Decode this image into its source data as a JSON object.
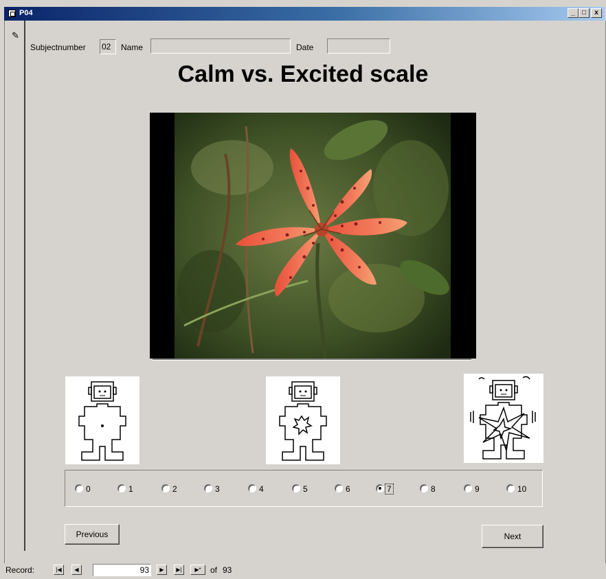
{
  "window": {
    "title": "P04",
    "minimize": "_",
    "maximize": "□",
    "close": "x"
  },
  "header": {
    "subject_label": "Subjectnumber",
    "subject_value": "02",
    "name_label": "Name",
    "name_value": "",
    "date_label": "Date",
    "date_value": ""
  },
  "heading": "Calm vs. Excited scale",
  "scale": {
    "options": [
      "0",
      "1",
      "2",
      "3",
      "4",
      "5",
      "6",
      "7",
      "8",
      "9",
      "10"
    ],
    "selected": "7"
  },
  "buttons": {
    "previous": "Previous",
    "next": "Next"
  },
  "record_nav": {
    "label": "Record:",
    "current": "93",
    "of_label": "of",
    "total": "93"
  },
  "icons": {
    "form": "pencil-icon",
    "nav_first": "first-record-icon",
    "nav_prev": "previous-record-icon",
    "nav_next": "next-record-icon",
    "nav_last": "last-record-icon",
    "nav_new": "new-record-icon"
  },
  "colors": {
    "titlebar_start": "#0a246a",
    "titlebar_end": "#a6caf0",
    "face": "#d6d3ce"
  }
}
